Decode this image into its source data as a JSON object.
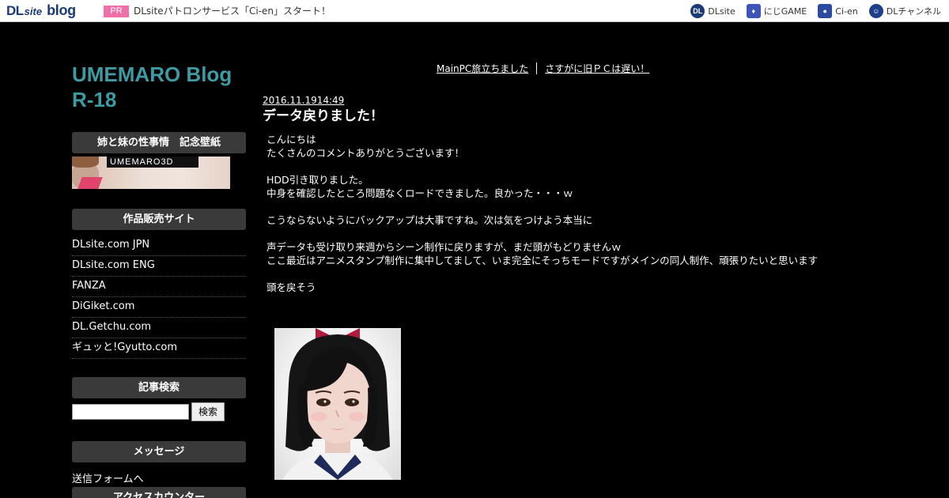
{
  "topbar": {
    "brand_main": "DL",
    "brand_sub": "site",
    "brand_blog": "blog",
    "pr_badge": "PR",
    "pr_text": "DLsiteパトロンサービス「Ci-en」スタート！",
    "services": [
      {
        "label": "DLsite",
        "icon": "dlsite-icon"
      },
      {
        "label": "にじGAME",
        "icon": "nijigame-icon"
      },
      {
        "label": "Ci-en",
        "icon": "cien-icon"
      },
      {
        "label": "DLチャンネル",
        "icon": "dlchannel-icon"
      }
    ]
  },
  "sidebar": {
    "blog_title": "UMEMARO Blog R-18",
    "wallpaper_heading": "姉と妹の性事情　記念壁紙",
    "wallpaper_logo": "UMEMARO3D",
    "shop_heading": "作品販売サイト",
    "shops": [
      "DLsite.com JPN",
      "DLsite.com ENG",
      "FANZA",
      "DiGiket.com",
      "DL.Getchu.com",
      "ギュッと!Gyutto.com"
    ],
    "search_heading": "記事検索",
    "search_value": "",
    "search_button": "検索",
    "message_heading": "メッセージ",
    "message_link": "送信フォームへ",
    "counter_heading": "アクセスカウンター"
  },
  "main": {
    "prev_link": "MainPC旅立ちました",
    "next_link": "さすがに旧ＰＣは遅い！",
    "date": "2016.11.1914:49",
    "title": "データ戻りました！",
    "body": [
      "こんにちは",
      "たくさんのコメントありがとうございます！",
      "",
      "HDD引き取りました。",
      "中身を確認したところ問題なくロードできました。良かった・・・ｗ",
      "",
      "こうならないようにバックアップは大事ですね。次は気をつけよう本当に",
      "",
      "声データも受け取り来週からシーン制作に戻りますが、まだ頭がもどりませんｗ",
      "ここ最近はアニメスタンプ制作に集中してまして、いま完全にそっちモードですがメインの同人制作、頑張りたいと思います",
      "",
      "頭を戻そう"
    ]
  },
  "colors": {
    "background": "#000000",
    "title_accent": "#3e9aa3",
    "widget_head": "#3a3a3a",
    "pr_badge": "#f06fa8"
  }
}
